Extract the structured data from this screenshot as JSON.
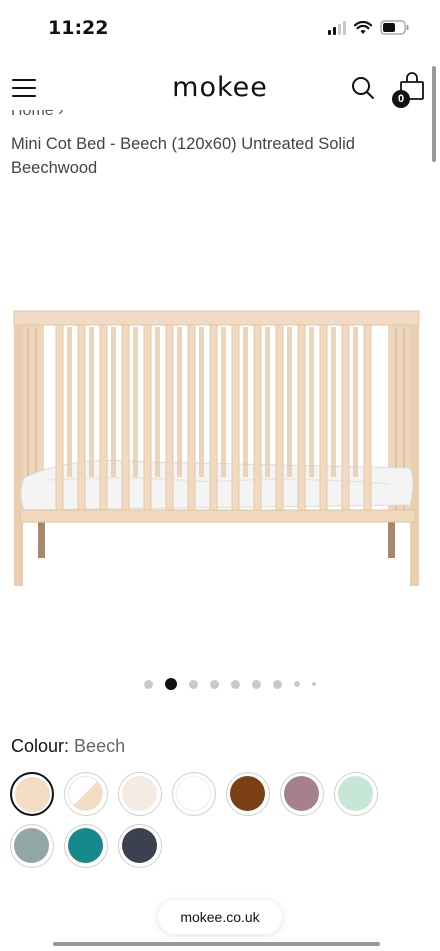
{
  "status_bar": {
    "time": "11:22"
  },
  "header": {
    "logo": "mokee",
    "cart_count": "0"
  },
  "breadcrumb": {
    "home": "Home",
    "separator": "›"
  },
  "product": {
    "title": "Mini Cot Bed - Beech (120x60) Untreated Solid Beechwood",
    "image_alt": "Mini Cot Bed in natural beech with white mattress"
  },
  "carousel": {
    "total_dots": 9,
    "active_index": 1
  },
  "colour": {
    "label": "Colour:",
    "selected": "Beech",
    "swatches": [
      {
        "name": "Beech",
        "color": "#f2dcc4",
        "selected": true
      },
      {
        "name": "White/Beech",
        "color": "#ffffff",
        "accent": "#f2dcc4",
        "selected": false
      },
      {
        "name": "Ivory",
        "color": "#f4ebe3",
        "selected": false
      },
      {
        "name": "White",
        "color": "#ffffff",
        "selected": false
      },
      {
        "name": "Walnut",
        "color": "#7b3f14",
        "selected": false
      },
      {
        "name": "Mauve",
        "color": "#a6808a",
        "selected": false
      },
      {
        "name": "Mint",
        "color": "#c6e7d6",
        "selected": false
      },
      {
        "name": "Sage Grey",
        "color": "#90a7a5",
        "selected": false
      },
      {
        "name": "Teal",
        "color": "#17898b",
        "selected": false
      },
      {
        "name": "Navy",
        "color": "#3b4150",
        "selected": false
      }
    ]
  },
  "browser": {
    "url": "mokee.co.uk"
  }
}
